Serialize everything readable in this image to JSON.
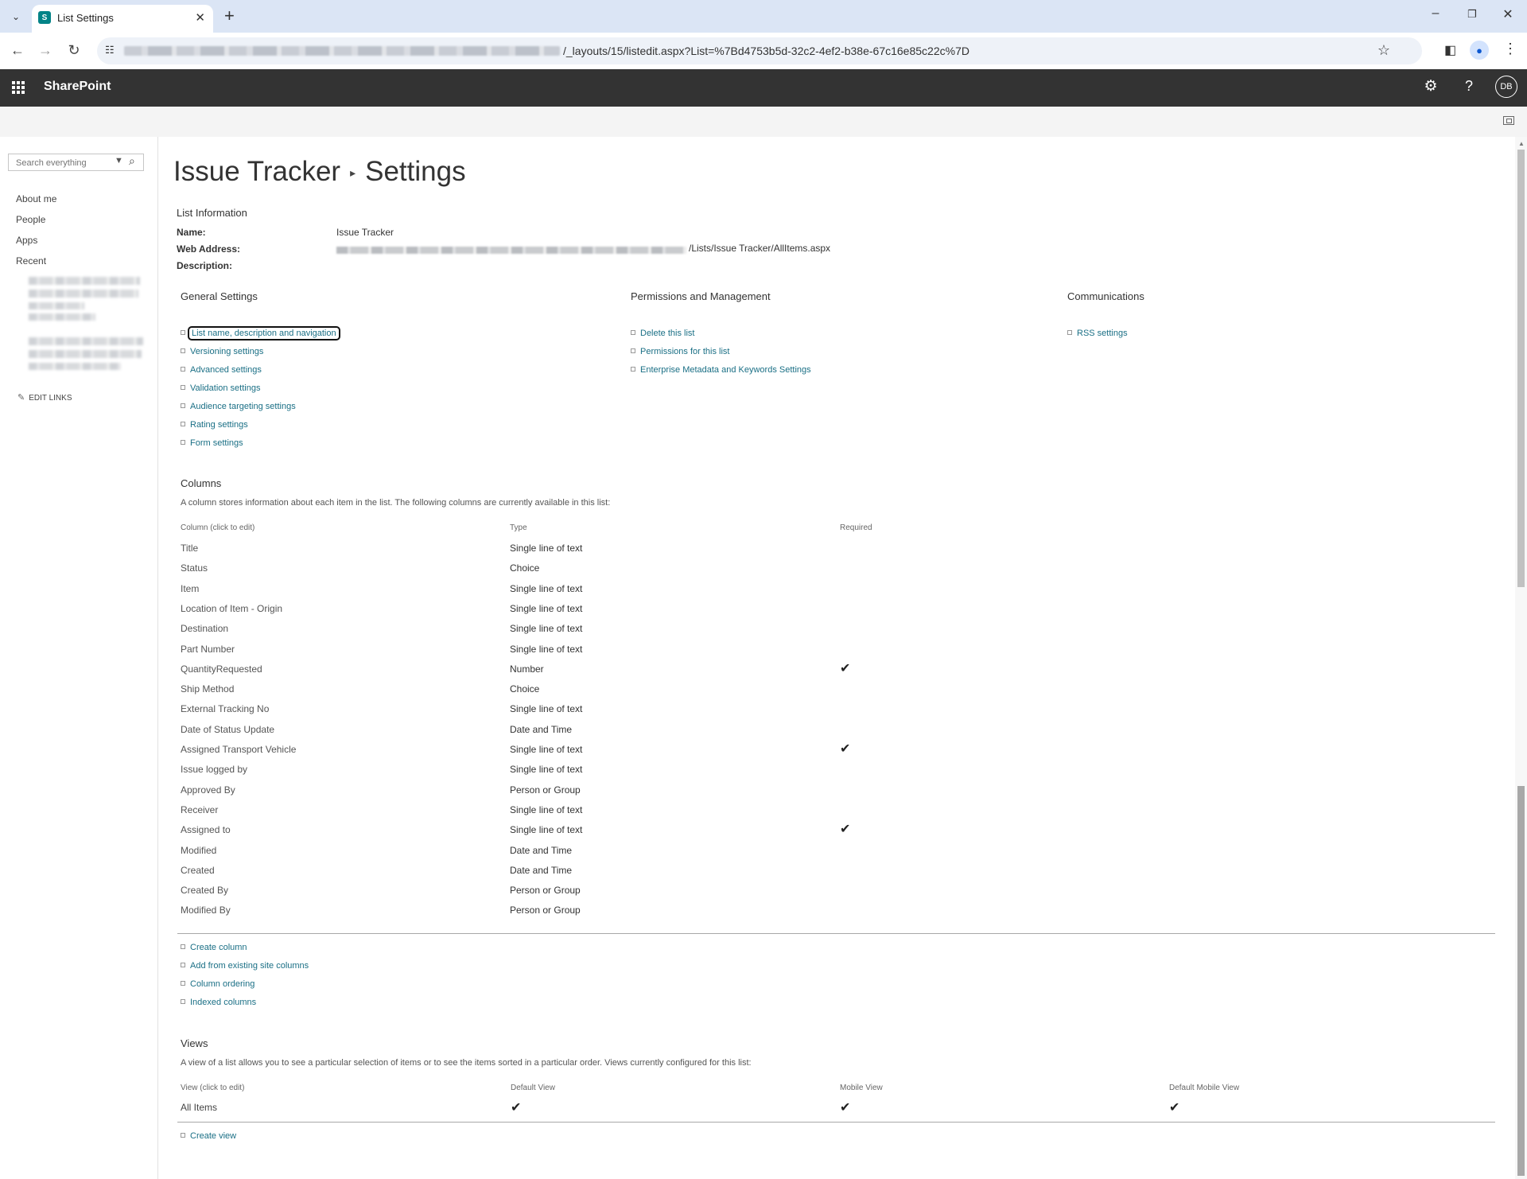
{
  "browser": {
    "tab_title": "List Settings",
    "url_path": "/_layouts/15/listedit.aspx?List=%7Bd4753b5d-32c2-4ef2-b38e-67c16e85c22c%7D"
  },
  "suitebar": {
    "brand": "SharePoint",
    "avatar_initials": "DB"
  },
  "leftnav": {
    "search_placeholder": "Search everything",
    "items": [
      "About me",
      "People",
      "Apps",
      "Recent"
    ],
    "edit_links": "EDIT LINKS"
  },
  "page": {
    "title_list": "Issue Tracker",
    "title_settings": "Settings"
  },
  "list_info": {
    "heading": "List Information",
    "name_label": "Name:",
    "name_value": "Issue Tracker",
    "address_label": "Web Address:",
    "address_tail": "/Lists/Issue Tracker/AllItems.aspx",
    "description_label": "Description:"
  },
  "general_settings": {
    "heading": "General Settings",
    "links": [
      "List name, description and navigation",
      "Versioning settings",
      "Advanced settings",
      "Validation settings",
      "Audience targeting settings",
      "Rating settings",
      "Form settings"
    ]
  },
  "permissions": {
    "heading": "Permissions and Management",
    "links": [
      "Delete this list",
      "Permissions for this list",
      "Enterprise Metadata and Keywords Settings"
    ]
  },
  "communications": {
    "heading": "Communications",
    "links": [
      "RSS settings"
    ]
  },
  "columns": {
    "heading": "Columns",
    "description": "A column stores information about each item in the list. The following columns are currently available in this list:",
    "headers": [
      "Column (click to edit)",
      "Type",
      "Required"
    ],
    "rows": [
      {
        "name": "Title",
        "type": "Single line of text",
        "required": false
      },
      {
        "name": "Status",
        "type": "Choice",
        "required": false
      },
      {
        "name": "Item",
        "type": "Single line of text",
        "required": false
      },
      {
        "name": "Location of Item - Origin",
        "type": "Single line of text",
        "required": false
      },
      {
        "name": "Destination",
        "type": "Single line of text",
        "required": false
      },
      {
        "name": "Part Number",
        "type": "Single line of text",
        "required": false
      },
      {
        "name": "QuantityRequested",
        "type": "Number",
        "required": true
      },
      {
        "name": "Ship Method",
        "type": "Choice",
        "required": false
      },
      {
        "name": "External Tracking No",
        "type": "Single line of text",
        "required": false
      },
      {
        "name": "Date of Status Update",
        "type": "Date and Time",
        "required": false
      },
      {
        "name": "Assigned Transport Vehicle",
        "type": "Single line of text",
        "required": true
      },
      {
        "name": "Issue logged by",
        "type": "Single line of text",
        "required": false
      },
      {
        "name": "Approved By",
        "type": "Person or Group",
        "required": false
      },
      {
        "name": "Receiver",
        "type": "Single line of text",
        "required": false
      },
      {
        "name": "Assigned to",
        "type": "Single line of text",
        "required": true
      },
      {
        "name": "Modified",
        "type": "Date and Time",
        "required": false
      },
      {
        "name": "Created",
        "type": "Date and Time",
        "required": false
      },
      {
        "name": "Created By",
        "type": "Person or Group",
        "required": false
      },
      {
        "name": "Modified By",
        "type": "Person or Group",
        "required": false
      }
    ],
    "links": [
      "Create column",
      "Add from existing site columns",
      "Column ordering",
      "Indexed columns"
    ]
  },
  "views": {
    "heading": "Views",
    "description": "A view of a list allows you to see a particular selection of items or to see the items sorted in a particular order. Views currently configured for this list:",
    "headers": [
      "View (click to edit)",
      "Default View",
      "Mobile View",
      "Default Mobile View"
    ],
    "rows": [
      {
        "name": "All Items",
        "default_view": true,
        "mobile_view": true,
        "default_mobile_view": true
      }
    ],
    "links": [
      "Create view"
    ]
  },
  "icons": {
    "check": "checkmark-icon",
    "colors": {
      "suitebar": "#333333",
      "link": "#1a6f85",
      "tabbar": "#dbe5f5"
    }
  }
}
